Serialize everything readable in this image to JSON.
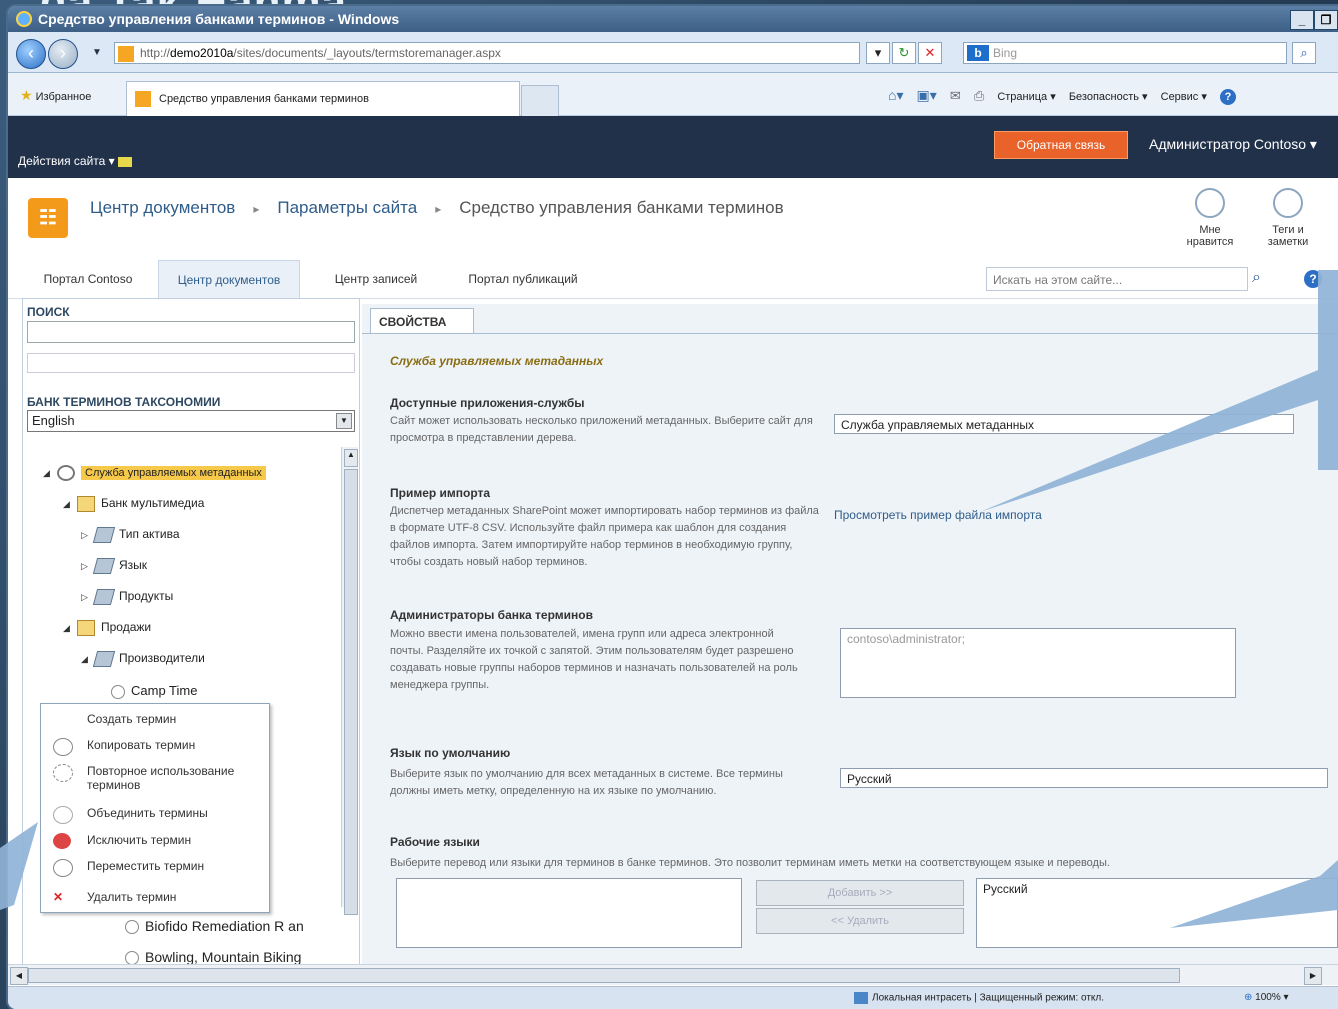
{
  "slide": {
    "title_fragment": "ga Tak Hanma"
  },
  "window": {
    "title": "Средство управления банками терминов - Windows"
  },
  "browser": {
    "address_prefix": "http://",
    "address_host": "demo2010a",
    "address_path": "/sites/documents/_layouts/termstoremanager.aspx",
    "search_placeholder": "Bing",
    "favorites_label": "Избранное",
    "tab_title": "Средство управления банками терминов",
    "cmd_page": "Страница ▾",
    "cmd_security": "Безопасность ▾",
    "cmd_service": "Сервис ▾"
  },
  "sp": {
    "site_actions": "Действия сайта ▾",
    "feedback": "Обратная связь",
    "user": "Администратор Contoso ▾",
    "breadcrumb": [
      "Центр документов",
      "Параметры сайта",
      "Средство управления банками терминов"
    ],
    "like_label": "Мне нравится",
    "tags_label": "Теги и заметки",
    "topnav": [
      "Портал Contoso",
      "Центр документов",
      "Центр записей",
      "Портал публикаций"
    ],
    "site_search_placeholder": "Искать на этом сайте..."
  },
  "left": {
    "search_header": "ПОИСК",
    "taxonomy_header": "БАНК ТЕРМИНОВ ТАКСОНОМИИ",
    "language_value": "English",
    "tree": [
      {
        "label": "Служба управляемых метаданных",
        "level": 0,
        "icon": "service-icon",
        "selected": true
      },
      {
        "label": "Банк мультимедиа",
        "level": 1,
        "icon": "group-icon"
      },
      {
        "label": "Тип актива",
        "level": 2,
        "icon": "termset-icon"
      },
      {
        "label": "Язык",
        "level": 2,
        "icon": "termset-icon"
      },
      {
        "label": "Продукты",
        "level": 2,
        "icon": "termset-icon"
      },
      {
        "label": "Продажи",
        "level": 1,
        "icon": "group-icon"
      },
      {
        "label": "Производители",
        "level": 2,
        "icon": "termset-icon"
      },
      {
        "label": "Camp Time",
        "level": 3,
        "icon": "term-icon"
      },
      {
        "label": "Biofido Remediation R an",
        "level": 3,
        "icon": "term-icon"
      },
      {
        "label": "Bowling, Mountain Biking",
        "level": 3,
        "icon": "term-icon"
      }
    ],
    "context_menu": [
      "Создать термин",
      "Копировать термин",
      "Повторное использование терминов",
      "Объединить термины",
      "Исключить термин",
      "Переместить термин",
      "Удалить термин"
    ]
  },
  "right": {
    "tab": "СВОЙСТВА",
    "service_title": "Служба управляемых метаданных",
    "apps_title": "Доступные приложения-службы",
    "apps_desc": "Сайт может использовать несколько приложений метаданных. Выберите сайт для просмотра в представлении дерева.",
    "apps_value": "Служба управляемых метаданных",
    "import_title": "Пример импорта",
    "import_desc": "Диспетчер метаданных SharePoint может импортировать набор терминов из файла в формате UTF-8 CSV. Используйте файл примера как шаблон для создания файлов импорта. Затем импортируйте набор терминов в необходимую группу, чтобы создать новый набор терминов.",
    "import_link": "Просмотреть пример файла импорта",
    "admins_title": "Администраторы банка терминов",
    "admins_desc": "Можно ввести имена пользователей, имена групп или адреса электронной почты. Разделяйте их точкой с запятой. Этим пользователям будет разрешено создавать новые группы наборов терминов и назначать пользователей на роль менеджера группы.",
    "admins_value": "contoso\\administrator;",
    "deflang_title": "Язык по умолчанию",
    "deflang_desc": "Выберите язык по умолчанию для всех метаданных в системе. Все термины должны иметь метку, определенную на их языке по умолчанию.",
    "deflang_value": "Русский",
    "worklang_title": "Рабочие языки",
    "worklang_desc": "Выберите перевод или языки для терминов в банке терминов. Это позволит терминам иметь метки на соответствующем языке и переводы.",
    "add_btn": "Добавить >>",
    "remove_btn": "<< Удалить",
    "selected_lang": "Русский"
  },
  "status": {
    "zone": "Локальная интрасеть | Защищенный режим: откл.",
    "zoom": "100%"
  },
  "colors": {
    "feedback": "#e8622a",
    "sp_header": "#21314a",
    "link": "#2f5d8a"
  }
}
